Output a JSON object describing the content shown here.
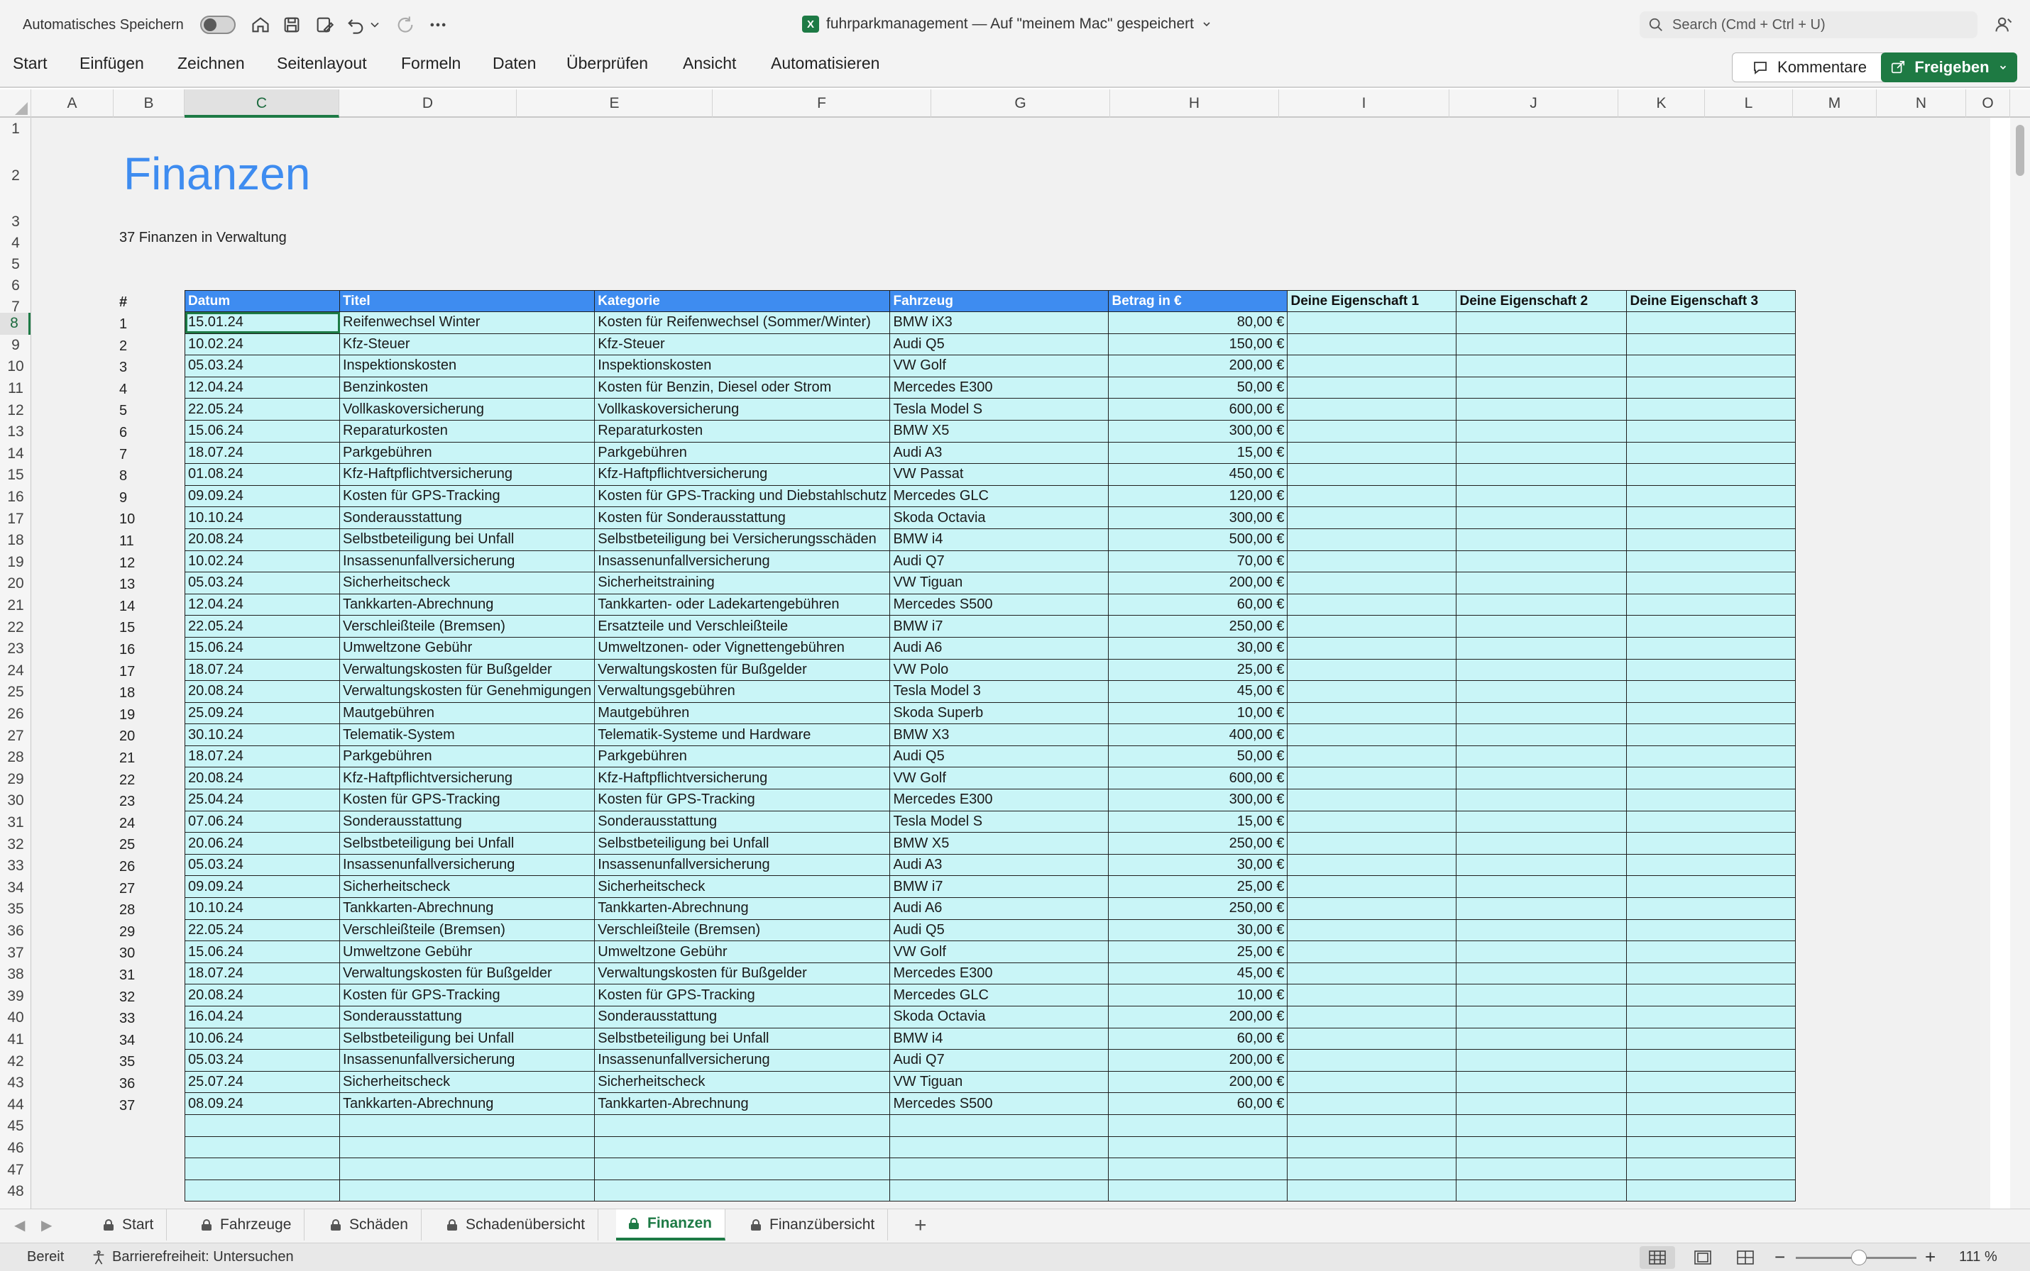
{
  "titlebar": {
    "autosave_label": "Automatisches Speichern",
    "doc_title": "fuhrparkmanagement — Auf \"meinem Mac\" gespeichert",
    "search_placeholder": "Search (Cmd + Ctrl + U)"
  },
  "ribbon": {
    "tabs": [
      "Start",
      "Einfügen",
      "Zeichnen",
      "Seitenlayout",
      "Formeln",
      "Daten",
      "Überprüfen",
      "Ansicht",
      "Automatisieren"
    ],
    "comments_label": "Kommentare",
    "share_label": "Freigeben"
  },
  "columns": [
    "A",
    "B",
    "C",
    "D",
    "E",
    "F",
    "G",
    "H",
    "I",
    "J",
    "K",
    "L",
    "M",
    "N",
    "O"
  ],
  "sheet": {
    "title": "Finanzen",
    "subtitle": "37 Finanzen in Verwaltung",
    "index_header": "#",
    "headers": [
      "Datum",
      "Titel",
      "Kategorie",
      "Fahrzeug",
      "Betrag in €",
      "Deine Eigenschaft 1",
      "Deine Eigenschaft 2",
      "Deine Eigenschaft 3"
    ],
    "rows": [
      [
        "1",
        "15.01.24",
        "Reifenwechsel Winter",
        "Kosten für Reifenwechsel (Sommer/Winter)",
        "BMW iX3",
        "80,00 €"
      ],
      [
        "2",
        "10.02.24",
        "Kfz-Steuer",
        "Kfz-Steuer",
        "Audi Q5",
        "150,00 €"
      ],
      [
        "3",
        "05.03.24",
        "Inspektionskosten",
        "Inspektionskosten",
        "VW Golf",
        "200,00 €"
      ],
      [
        "4",
        "12.04.24",
        "Benzinkosten",
        "Kosten für Benzin, Diesel oder Strom",
        "Mercedes E300",
        "50,00 €"
      ],
      [
        "5",
        "22.05.24",
        "Vollkaskoversicherung",
        "Vollkaskoversicherung",
        "Tesla Model S",
        "600,00 €"
      ],
      [
        "6",
        "15.06.24",
        "Reparaturkosten",
        "Reparaturkosten",
        "BMW X5",
        "300,00 €"
      ],
      [
        "7",
        "18.07.24",
        "Parkgebühren",
        "Parkgebühren",
        "Audi A3",
        "15,00 €"
      ],
      [
        "8",
        "01.08.24",
        "Kfz-Haftpflichtversicherung",
        "Kfz-Haftpflichtversicherung",
        "VW Passat",
        "450,00 €"
      ],
      [
        "9",
        "09.09.24",
        "Kosten für GPS-Tracking",
        "Kosten für GPS-Tracking und Diebstahlschutz",
        "Mercedes GLC",
        "120,00 €"
      ],
      [
        "10",
        "10.10.24",
        "Sonderausstattung",
        "Kosten für Sonderausstattung",
        "Skoda Octavia",
        "300,00 €"
      ],
      [
        "11",
        "20.08.24",
        "Selbstbeteiligung bei Unfall",
        "Selbstbeteiligung bei Versicherungsschäden",
        "BMW i4",
        "500,00 €"
      ],
      [
        "12",
        "10.02.24",
        "Insassenunfallversicherung",
        "Insassenunfallversicherung",
        "Audi Q7",
        "70,00 €"
      ],
      [
        "13",
        "05.03.24",
        "Sicherheitscheck",
        "Sicherheitstraining",
        "VW Tiguan",
        "200,00 €"
      ],
      [
        "14",
        "12.04.24",
        "Tankkarten-Abrechnung",
        "Tankkarten- oder Ladekartengebühren",
        "Mercedes S500",
        "60,00 €"
      ],
      [
        "15",
        "22.05.24",
        "Verschleißteile (Bremsen)",
        "Ersatzteile und Verschleißteile",
        "BMW i7",
        "250,00 €"
      ],
      [
        "16",
        "15.06.24",
        "Umweltzone Gebühr",
        "Umweltzonen- oder Vignettengebühren",
        "Audi A6",
        "30,00 €"
      ],
      [
        "17",
        "18.07.24",
        "Verwaltungskosten für Bußgelder",
        "Verwaltungskosten für Bußgelder",
        "VW Polo",
        "25,00 €"
      ],
      [
        "18",
        "20.08.24",
        "Verwaltungskosten für Genehmigungen",
        "Verwaltungsgebühren",
        "Tesla Model 3",
        "45,00 €"
      ],
      [
        "19",
        "25.09.24",
        "Mautgebühren",
        "Mautgebühren",
        "Skoda Superb",
        "10,00 €"
      ],
      [
        "20",
        "30.10.24",
        "Telematik-System",
        "Telematik-Systeme und Hardware",
        "BMW X3",
        "400,00 €"
      ],
      [
        "21",
        "18.07.24",
        "Parkgebühren",
        "Parkgebühren",
        "Audi Q5",
        "50,00 €"
      ],
      [
        "22",
        "20.08.24",
        "Kfz-Haftpflichtversicherung",
        "Kfz-Haftpflichtversicherung",
        "VW Golf",
        "600,00 €"
      ],
      [
        "23",
        "25.04.24",
        "Kosten für GPS-Tracking",
        "Kosten für GPS-Tracking",
        "Mercedes E300",
        "300,00 €"
      ],
      [
        "24",
        "07.06.24",
        "Sonderausstattung",
        "Sonderausstattung",
        "Tesla Model S",
        "15,00 €"
      ],
      [
        "25",
        "20.06.24",
        "Selbstbeteiligung bei Unfall",
        "Selbstbeteiligung bei Unfall",
        "BMW X5",
        "250,00 €"
      ],
      [
        "26",
        "05.03.24",
        "Insassenunfallversicherung",
        "Insassenunfallversicherung",
        "Audi A3",
        "30,00 €"
      ],
      [
        "27",
        "09.09.24",
        "Sicherheitscheck",
        "Sicherheitscheck",
        "BMW i7",
        "25,00 €"
      ],
      [
        "28",
        "10.10.24",
        "Tankkarten-Abrechnung",
        "Tankkarten-Abrechnung",
        "Audi A6",
        "250,00 €"
      ],
      [
        "29",
        "22.05.24",
        "Verschleißteile (Bremsen)",
        "Verschleißteile (Bremsen)",
        "Audi Q5",
        "30,00 €"
      ],
      [
        "30",
        "15.06.24",
        "Umweltzone Gebühr",
        "Umweltzone Gebühr",
        "VW Golf",
        "25,00 €"
      ],
      [
        "31",
        "18.07.24",
        "Verwaltungskosten für Bußgelder",
        "Verwaltungskosten für Bußgelder",
        "Mercedes E300",
        "45,00 €"
      ],
      [
        "32",
        "20.08.24",
        "Kosten für GPS-Tracking",
        "Kosten für GPS-Tracking",
        "Mercedes GLC",
        "10,00 €"
      ],
      [
        "33",
        "16.04.24",
        "Sonderausstattung",
        "Sonderausstattung",
        "Skoda Octavia",
        "200,00 €"
      ],
      [
        "34",
        "10.06.24",
        "Selbstbeteiligung bei Unfall",
        "Selbstbeteiligung bei Unfall",
        "BMW i4",
        "60,00 €"
      ],
      [
        "35",
        "05.03.24",
        "Insassenunfallversicherung",
        "Insassenunfallversicherung",
        "Audi Q7",
        "200,00 €"
      ],
      [
        "36",
        "25.07.24",
        "Sicherheitscheck",
        "Sicherheitscheck",
        "VW Tiguan",
        "200,00 €"
      ],
      [
        "37",
        "08.09.24",
        "Tankkarten-Abrechnung",
        "Tankkarten-Abrechnung",
        "Mercedes S500",
        "60,00 €"
      ]
    ],
    "empty_rows": 4
  },
  "sheet_tabs": [
    "Start",
    "Fahrzeuge",
    "Schäden",
    "Schadenübersicht",
    "Finanzen",
    "Finanzübersicht"
  ],
  "active_sheet": "Finanzen",
  "status": {
    "ready": "Bereit",
    "accessibility": "Barrierefreiheit: Untersuchen",
    "zoom": "111 %"
  },
  "colors": {
    "accent_green": "#1d7a45",
    "header_blue": "#3e8cf0",
    "row_cyan": "#c9f5f7"
  }
}
